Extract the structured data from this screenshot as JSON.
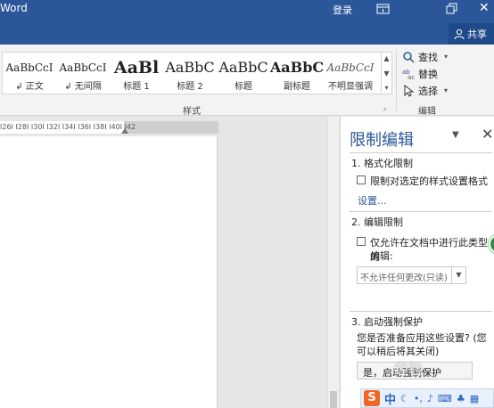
{
  "titlebar": {
    "app_title": "Word",
    "login_label": "登录",
    "share_label": "共享"
  },
  "ribbon": {
    "styles": [
      {
        "sample": "AaBbCcI",
        "name": "正文",
        "mark": "↲"
      },
      {
        "sample": "AaBbCcI",
        "name": "无间隔",
        "mark": "↲"
      },
      {
        "sample": "AaBl",
        "name": "标题 1",
        "mark": ""
      },
      {
        "sample": "AaBbC",
        "name": "标题 2",
        "mark": ""
      },
      {
        "sample": "AaBbC",
        "name": "标题",
        "mark": ""
      },
      {
        "sample": "AaBbC",
        "name": "副标题",
        "mark": ""
      },
      {
        "sample": "AaBbCcI",
        "name": "不明显强调",
        "mark": ""
      }
    ],
    "styles_group_label": "样式",
    "editing": {
      "find_label": "查找",
      "replace_label": "替换",
      "select_label": "选择",
      "group_label": "编辑"
    }
  },
  "ruler": {
    "ticks": "I26I  I28I  I30I  I32I  I34I  I36I  I38I  I40I  I42"
  },
  "pane": {
    "title": "限制编辑",
    "section1": {
      "heading": "1. 格式化限制",
      "checkbox_label": "限制对选定的样式设置格式",
      "link_label": "设置..."
    },
    "section2": {
      "heading": "2. 编辑限制",
      "checkbox_label_line1": "仅允许在文档中进行此类型的",
      "checkbox_label_line2": "编辑:",
      "select_value": "不允许任何更改(只读)"
    },
    "section3": {
      "heading": "3. 启动强制保护",
      "prompt_text": "您是否准备应用这些设置? (您可以稍后将其关闭)",
      "start_button_label": "是，启动强制保护"
    }
  },
  "ime": {
    "mode": "中"
  },
  "watermark": "经验"
}
